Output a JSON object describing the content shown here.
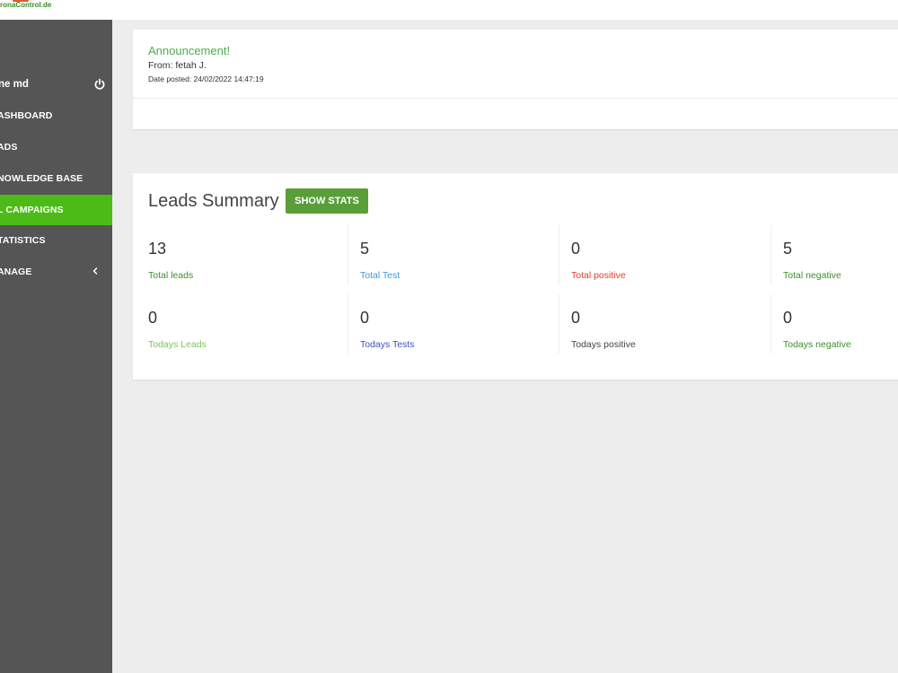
{
  "brand": {
    "logo_text": "ronaControl.de"
  },
  "sidebar": {
    "user_name": "ne md",
    "power_icon": "power-icon",
    "items": [
      {
        "label": "ASHBOARD",
        "active": false
      },
      {
        "label": "ADS",
        "active": false
      },
      {
        "label": "NOWLEDGE BASE",
        "active": false
      },
      {
        "label": "L CAMPAIGNS",
        "active": true
      },
      {
        "label": "TATISTICS",
        "active": false
      },
      {
        "label": "ANAGE",
        "active": false,
        "icon": "chevron-left-icon"
      }
    ],
    "colors": {
      "background": "#555555",
      "active": "#4cbb17"
    }
  },
  "announcement": {
    "title": "Announcement!",
    "from": "From: fetah J.",
    "date": "Date posted: 24/02/2022 14:47:19"
  },
  "leads_summary": {
    "title": "Leads Summary",
    "button_label": "SHOW STATS",
    "stats": [
      {
        "value": "13",
        "label": "Total leads",
        "color": "#3c8f2a"
      },
      {
        "value": "5",
        "label": "Total Test",
        "color": "#3a9ad9"
      },
      {
        "value": "0",
        "label": "Total positive",
        "color": "#e53935"
      },
      {
        "value": "5",
        "label": "Total negative",
        "color": "#3c8f2a"
      },
      {
        "value": "0",
        "label": "Todays Leads",
        "color": "#7cc45a"
      },
      {
        "value": "0",
        "label": "Todays Tests",
        "color": "#3b4fc4"
      },
      {
        "value": "0",
        "label": "Todays positive",
        "color": "#444444"
      },
      {
        "value": "0",
        "label": "Todays negative",
        "color": "#3c8f2a"
      }
    ]
  }
}
